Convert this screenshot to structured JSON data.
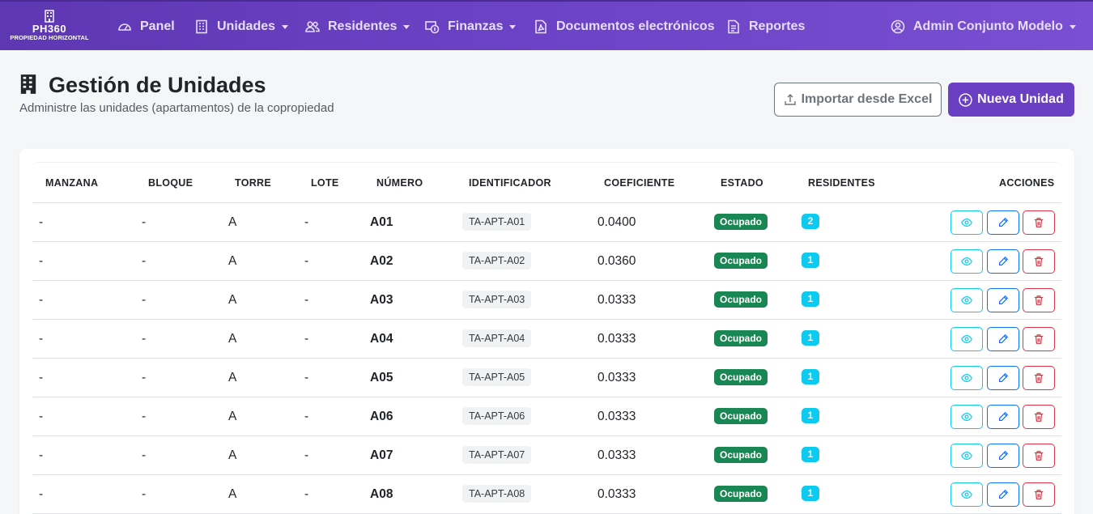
{
  "brand": {
    "name": "PH360",
    "subtitle": "PROPIEDAD HORIZONTAL"
  },
  "nav": [
    {
      "label": "Panel",
      "icon": "speedometer-icon",
      "dropdown": false
    },
    {
      "label": "Unidades",
      "icon": "building-icon",
      "dropdown": true
    },
    {
      "label": "Residentes",
      "icon": "people-icon",
      "dropdown": true
    },
    {
      "label": "Finanzas",
      "icon": "cash-coin-icon",
      "dropdown": true
    },
    {
      "label": "Documentos electrónicos",
      "icon": "file-pdf-icon",
      "dropdown": false
    },
    {
      "label": "Reportes",
      "icon": "file-text-icon",
      "dropdown": false
    }
  ],
  "user": {
    "label": "Admin Conjunto Modelo",
    "icon": "person-circle-icon"
  },
  "page": {
    "title": "Gestión de Unidades",
    "subtitle": "Administre las unidades (apartamentos) de la copropiedad",
    "import_label": "Importar desde Excel",
    "new_label": "Nueva Unidad"
  },
  "table": {
    "headers": [
      "MANZANA",
      "BLOQUE",
      "TORRE",
      "LOTE",
      "NÚMERO",
      "IDENTIFICADOR",
      "COEFICIENTE",
      "ESTADO",
      "RESIDENTES",
      "ACCIONES"
    ],
    "rows": [
      {
        "manzana": "-",
        "bloque": "-",
        "torre": "A",
        "lote": "-",
        "numero": "A01",
        "identificador": "TA-APT-A01",
        "coeficiente": "0.0400",
        "estado": "Ocupado",
        "residentes": "2"
      },
      {
        "manzana": "-",
        "bloque": "-",
        "torre": "A",
        "lote": "-",
        "numero": "A02",
        "identificador": "TA-APT-A02",
        "coeficiente": "0.0360",
        "estado": "Ocupado",
        "residentes": "1"
      },
      {
        "manzana": "-",
        "bloque": "-",
        "torre": "A",
        "lote": "-",
        "numero": "A03",
        "identificador": "TA-APT-A03",
        "coeficiente": "0.0333",
        "estado": "Ocupado",
        "residentes": "1"
      },
      {
        "manzana": "-",
        "bloque": "-",
        "torre": "A",
        "lote": "-",
        "numero": "A04",
        "identificador": "TA-APT-A04",
        "coeficiente": "0.0333",
        "estado": "Ocupado",
        "residentes": "1"
      },
      {
        "manzana": "-",
        "bloque": "-",
        "torre": "A",
        "lote": "-",
        "numero": "A05",
        "identificador": "TA-APT-A05",
        "coeficiente": "0.0333",
        "estado": "Ocupado",
        "residentes": "1"
      },
      {
        "manzana": "-",
        "bloque": "-",
        "torre": "A",
        "lote": "-",
        "numero": "A06",
        "identificador": "TA-APT-A06",
        "coeficiente": "0.0333",
        "estado": "Ocupado",
        "residentes": "1"
      },
      {
        "manzana": "-",
        "bloque": "-",
        "torre": "A",
        "lote": "-",
        "numero": "A07",
        "identificador": "TA-APT-A07",
        "coeficiente": "0.0333",
        "estado": "Ocupado",
        "residentes": "1"
      },
      {
        "manzana": "-",
        "bloque": "-",
        "torre": "A",
        "lote": "-",
        "numero": "A08",
        "identificador": "TA-APT-A08",
        "coeficiente": "0.0333",
        "estado": "Ocupado",
        "residentes": "1"
      }
    ]
  },
  "colors": {
    "navbar": "#6c43c6",
    "primary": "#6a3fc4",
    "success": "#198754",
    "info": "#0dcaf0",
    "danger": "#dc3545"
  }
}
